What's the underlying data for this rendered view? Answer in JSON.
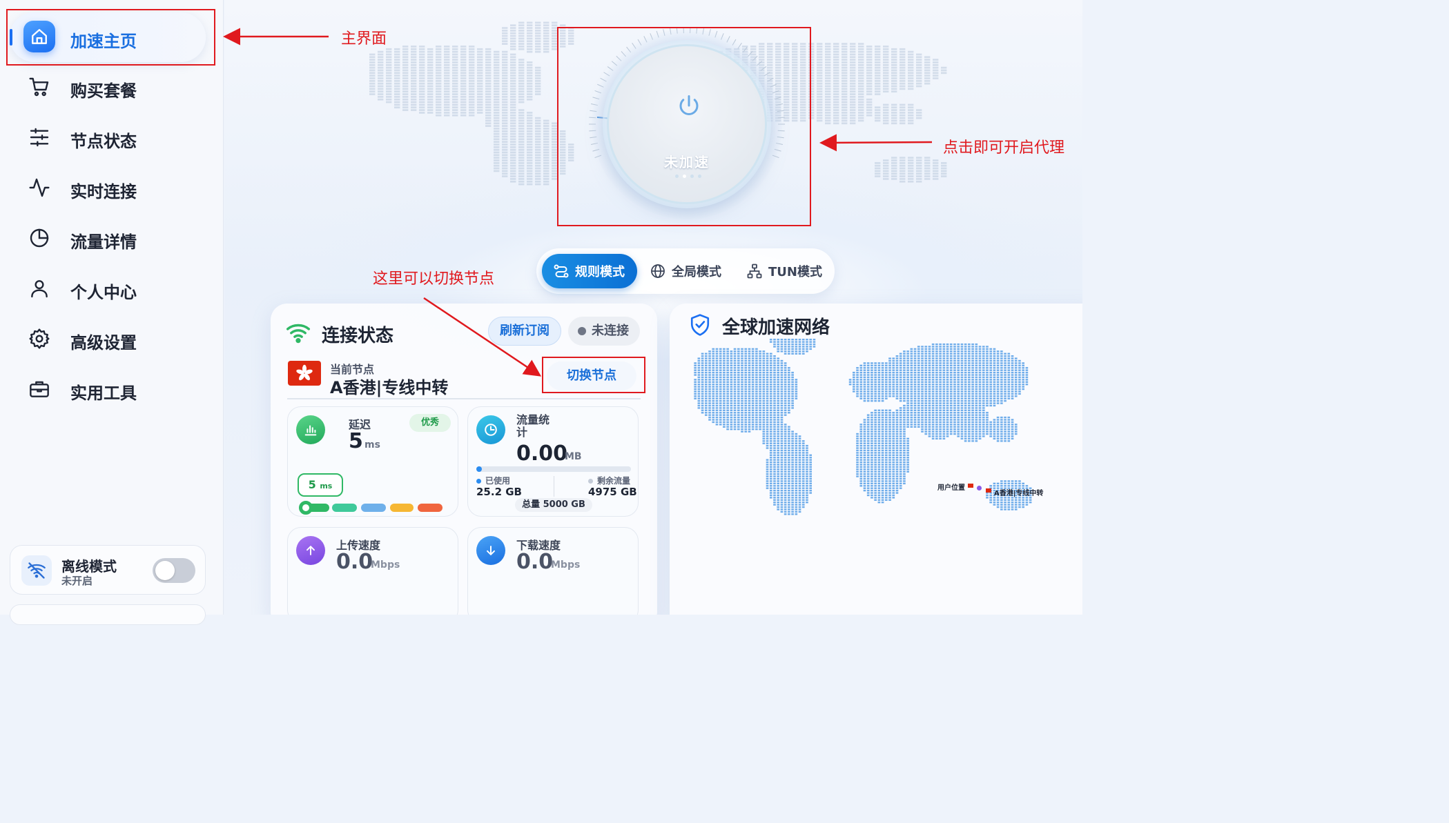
{
  "sidebar": {
    "items": [
      {
        "label": "加速主页",
        "icon": "home-icon",
        "active": true
      },
      {
        "label": "购买套餐",
        "icon": "cart-icon"
      },
      {
        "label": "节点状态",
        "icon": "sliders-icon"
      },
      {
        "label": "实时连接",
        "icon": "activity-icon"
      },
      {
        "label": "流量详情",
        "icon": "pie-chart-icon"
      },
      {
        "label": "个人中心",
        "icon": "user-icon"
      },
      {
        "label": "高级设置",
        "icon": "gear-icon"
      },
      {
        "label": "实用工具",
        "icon": "toolbox-icon"
      }
    ],
    "offline": {
      "title": "离线模式",
      "status": "未开启",
      "enabled": false
    }
  },
  "power": {
    "label": "未加速"
  },
  "modes": [
    {
      "label": "规则模式",
      "icon": "route-icon",
      "active": true
    },
    {
      "label": "全局模式",
      "icon": "globe-icon"
    },
    {
      "label": "TUN模式",
      "icon": "network-icon"
    }
  ],
  "connection": {
    "title": "连接状态",
    "refresh_label": "刷新订阅",
    "status_label": "未连接",
    "node_caption": "当前节点",
    "node_name": "A香港|专线中转",
    "switch_label": "切换节点"
  },
  "stats": {
    "latency": {
      "title": "延迟",
      "value": "5",
      "unit": "ms",
      "badge": "优秀",
      "bubble_value": "5",
      "bubble_unit": "ms"
    },
    "traffic": {
      "title": "流量统计",
      "value": "0.00",
      "unit": "MB",
      "used_label": "已使用",
      "used_value": "25.2 GB",
      "remain_label": "剩余流量",
      "remain_value": "4975 GB",
      "total_label": "总量 5000 GB",
      "used_fraction": 0.005
    },
    "upload": {
      "title": "上传速度",
      "value": "0.0",
      "unit": "Mbps"
    },
    "download": {
      "title": "下载速度",
      "value": "0.0",
      "unit": "Mbps"
    }
  },
  "network": {
    "title": "全球加速网络",
    "user_pin": "用户位置",
    "node_pin": "A香港|专线中转"
  },
  "annotations": {
    "home": "主界面",
    "power": "点击即可开启代理",
    "switch": "这里可以切换节点"
  },
  "colors": {
    "accent": "#1b6ff2",
    "annotation": "#e0191e",
    "success": "#2fb865",
    "map": "#5ea3e8"
  }
}
